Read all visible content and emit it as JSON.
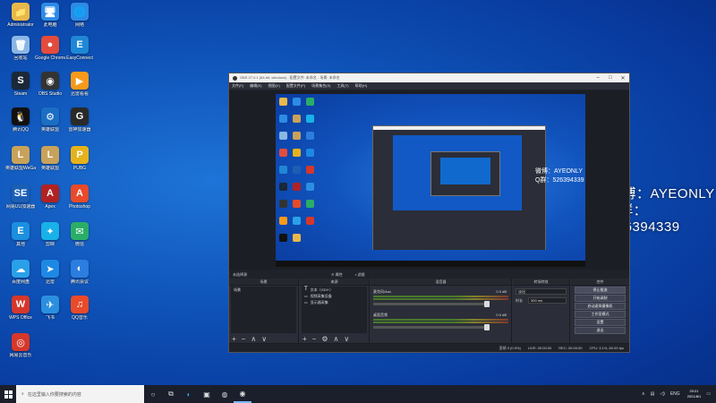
{
  "overlay": {
    "weibo": "微博：AYEONLY",
    "qq": "Q群：526394339"
  },
  "desktop_icons": [
    {
      "label": "Administrator",
      "color": "#e8b84a",
      "glyph": "📁"
    },
    {
      "label": "此电脑",
      "color": "#2d8be6",
      "glyph": "🖥"
    },
    {
      "label": "网络",
      "color": "#2d8be6",
      "glyph": "🌐"
    },
    {
      "label": "回收站",
      "color": "#8ab6e6",
      "glyph": "🗑"
    },
    {
      "label": "Google Chrome",
      "color": "#e34c3c",
      "glyph": "●"
    },
    {
      "label": "EasyConnect",
      "color": "#1f87d6",
      "glyph": "E"
    },
    {
      "label": "Steam",
      "color": "#1b2838",
      "glyph": "S"
    },
    {
      "label": "OBS Studio",
      "color": "#333333",
      "glyph": "◉"
    },
    {
      "label": "迅雷看看",
      "color": "#f59a1b",
      "glyph": "▶"
    },
    {
      "label": "腾讯QQ",
      "color": "#111111",
      "glyph": "🐧"
    },
    {
      "label": "英雄联盟",
      "color": "#1a6ec4",
      "glyph": "⚙"
    },
    {
      "label": "雷神加速器",
      "color": "#2a2a2a",
      "glyph": "G"
    },
    {
      "label": "英雄联盟WeGame",
      "color": "#c9a25a",
      "glyph": "L"
    },
    {
      "label": "英雄联盟",
      "color": "#c9a25a",
      "glyph": "L"
    },
    {
      "label": "PUBG",
      "color": "#e6b21b",
      "glyph": "P"
    },
    {
      "label": "网易UU加速器",
      "color": "#1b5fb4",
      "glyph": "SE"
    },
    {
      "label": "Apex",
      "color": "#b22222",
      "glyph": "A"
    },
    {
      "label": "Photoshop",
      "color": "#e84a2a",
      "glyph": "A"
    },
    {
      "label": "其他",
      "color": "#1b8fe0",
      "glyph": "E"
    },
    {
      "label": "剪映",
      "color": "#18b1e8",
      "glyph": "✦"
    },
    {
      "label": "微信",
      "color": "#2aae67",
      "glyph": "✉"
    },
    {
      "label": "百度网盘",
      "color": "#2aa0e8",
      "glyph": "☁"
    },
    {
      "label": "迅雷",
      "color": "#1e88e5",
      "glyph": "➤"
    },
    {
      "label": "腾讯会议",
      "color": "#2b7de0",
      "glyph": "◐"
    },
    {
      "label": "WPS Office",
      "color": "#d6372b",
      "glyph": "W"
    },
    {
      "label": "飞书",
      "color": "#2b8fe0",
      "glyph": "✈"
    },
    {
      "label": "QQ音乐",
      "color": "#e84a2a",
      "glyph": "♫"
    },
    {
      "label": "网易云音乐",
      "color": "#d6372b",
      "glyph": "◎"
    }
  ],
  "obs": {
    "title": "OBS 27.0.1 (64-bit, windows) - 配置文件: 未命名 - 场景: 未命名",
    "menu": [
      "文件(F)",
      "编辑(E)",
      "视图(V)",
      "配置文件(P)",
      "场景集合(S)",
      "工具(T)",
      "帮助(H)"
    ],
    "source_hint": "未选择源",
    "props_label": "属性",
    "filter_label": "滤镜",
    "docks": {
      "scenes": {
        "title": "场景",
        "items": [
          "场景"
        ]
      },
      "sources": {
        "title": "来源",
        "items": [
          "文本（GDI+）",
          "视频采集设备",
          "显示器采集"
        ]
      },
      "mixer": {
        "title": "混音器",
        "channels": [
          {
            "name": "麦克风/Aux",
            "db": "0.0 dB"
          },
          {
            "name": "桌面音频",
            "db": "0.0 dB"
          }
        ]
      },
      "transitions": {
        "title": "转场特效",
        "type_label": "淡出",
        "duration_label": "时长",
        "duration": "300 ms"
      },
      "controls": {
        "title": "控件",
        "buttons": [
          "停止推流",
          "开始录制",
          "启动虚拟摄像机",
          "工作室模式",
          "设置",
          "退出"
        ]
      }
    },
    "status": {
      "dropped": "丢帧 0 (0.0%)",
      "live": "LIVE: 00:00:00",
      "rec": "REC: 00:00:00",
      "cpu": "CPU: 3.1%, 60.00 fps"
    }
  },
  "taskbar": {
    "search_placeholder": "在这里输入你要搜索的内容",
    "lang": "ENG",
    "time": "20:21",
    "date": "2021/8/1"
  }
}
